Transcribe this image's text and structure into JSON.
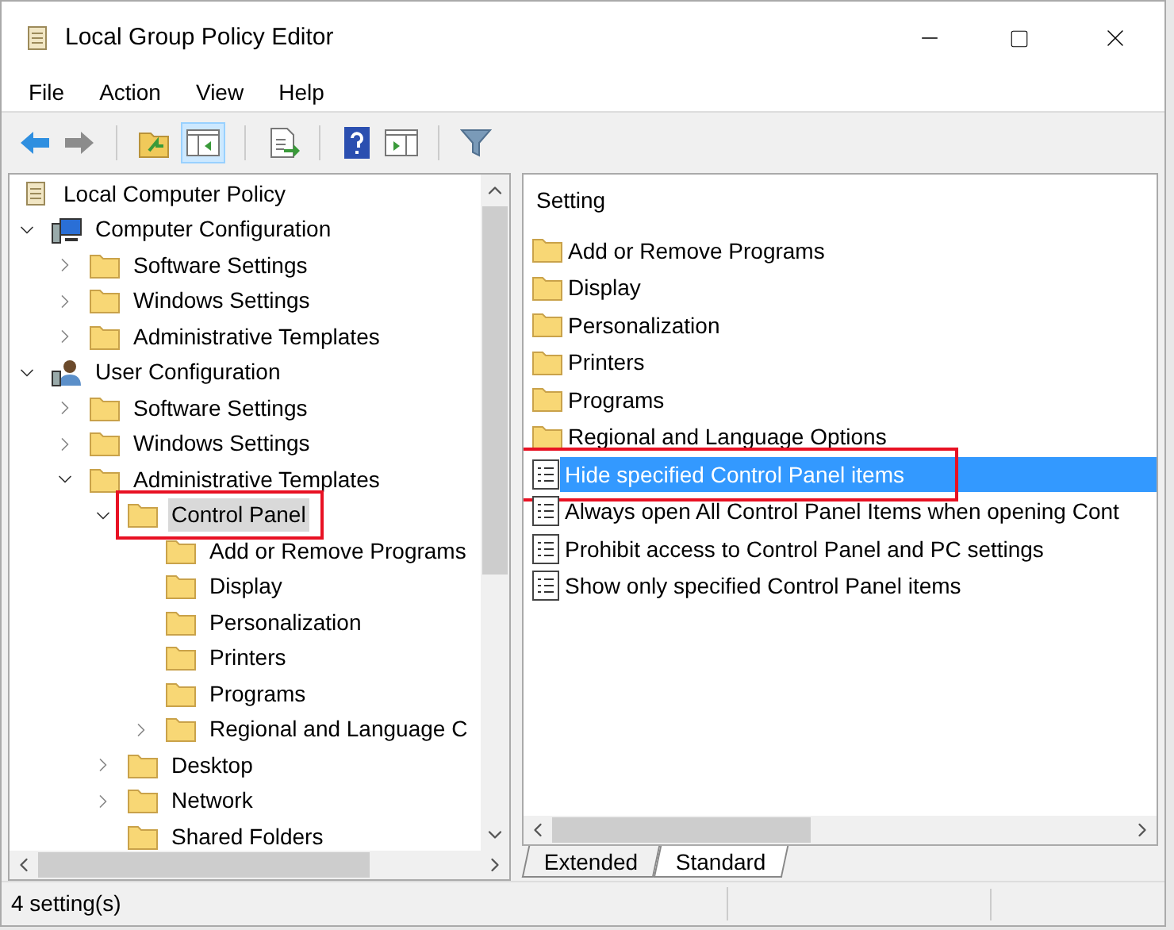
{
  "window": {
    "title": "Local Group Policy Editor"
  },
  "menu": [
    "File",
    "Action",
    "View",
    "Help"
  ],
  "toolbar": [
    {
      "kind": "back"
    },
    {
      "kind": "forward"
    },
    {
      "kind": "sep"
    },
    {
      "kind": "up"
    },
    {
      "kind": "tree",
      "selected": true
    },
    {
      "kind": "sep"
    },
    {
      "kind": "export"
    },
    {
      "kind": "sep"
    },
    {
      "kind": "help"
    },
    {
      "kind": "pane"
    },
    {
      "kind": "sep"
    },
    {
      "kind": "filter"
    }
  ],
  "tree": [
    {
      "label": "Local Computer Policy",
      "kind": "policy",
      "selected": false,
      "annotated": false,
      "children": [
        {
          "label": "Computer Configuration",
          "kind": "computer",
          "expanded": true,
          "selected": false,
          "annotated": false,
          "children": [
            {
              "label": "Software Settings",
              "kind": "folder",
              "expanded": false,
              "selected": false,
              "annotated": false
            },
            {
              "label": "Windows Settings",
              "kind": "folder",
              "expanded": false,
              "selected": false,
              "annotated": false
            },
            {
              "label": "Administrative Templates",
              "kind": "folder",
              "expanded": false,
              "selected": false,
              "annotated": false
            }
          ]
        },
        {
          "label": "User Configuration",
          "kind": "user",
          "expanded": true,
          "selected": false,
          "annotated": false,
          "children": [
            {
              "label": "Software Settings",
              "kind": "folder",
              "expanded": false,
              "selected": false,
              "annotated": false
            },
            {
              "label": "Windows Settings",
              "kind": "folder",
              "expanded": false,
              "selected": false,
              "annotated": false
            },
            {
              "label": "Administrative Templates",
              "kind": "folder",
              "expanded": true,
              "selected": false,
              "annotated": false,
              "children": [
                {
                  "label": "Control Panel",
                  "kind": "folder",
                  "expanded": true,
                  "selected": true,
                  "annotated": true,
                  "children": [
                    {
                      "label": "Add or Remove Programs",
                      "kind": "folder",
                      "selected": false,
                      "annotated": false
                    },
                    {
                      "label": "Display",
                      "kind": "folder",
                      "selected": false,
                      "annotated": false
                    },
                    {
                      "label": "Personalization",
                      "kind": "folder",
                      "selected": false,
                      "annotated": false
                    },
                    {
                      "label": "Printers",
                      "kind": "folder",
                      "selected": false,
                      "annotated": false
                    },
                    {
                      "label": "Programs",
                      "kind": "folder",
                      "selected": false,
                      "annotated": false
                    },
                    {
                      "label": "Regional and Language C",
                      "kind": "folder",
                      "expanded": false,
                      "selected": false,
                      "annotated": false
                    }
                  ]
                },
                {
                  "label": "Desktop",
                  "kind": "folder",
                  "expanded": false,
                  "selected": false,
                  "annotated": false
                },
                {
                  "label": "Network",
                  "kind": "folder",
                  "expanded": false,
                  "selected": false,
                  "annotated": false
                },
                {
                  "label": "Shared Folders",
                  "kind": "folder",
                  "selected": false,
                  "annotated": false
                }
              ]
            }
          ]
        }
      ]
    }
  ],
  "list": {
    "column": "Setting",
    "items": [
      {
        "label": "Add or Remove Programs",
        "kind": "folder",
        "selected": false,
        "annotated": false
      },
      {
        "label": "Display",
        "kind": "folder",
        "selected": false,
        "annotated": false
      },
      {
        "label": "Personalization",
        "kind": "folder",
        "selected": false,
        "annotated": false
      },
      {
        "label": "Printers",
        "kind": "folder",
        "selected": false,
        "annotated": false
      },
      {
        "label": "Programs",
        "kind": "folder",
        "selected": false,
        "annotated": false
      },
      {
        "label": "Regional and Language Options",
        "kind": "folder",
        "selected": false,
        "annotated": false
      },
      {
        "label": "Hide specified Control Panel items",
        "kind": "setting",
        "selected": true,
        "annotated": true
      },
      {
        "label": "Always open All Control Panel Items when opening Cont",
        "kind": "setting",
        "selected": false,
        "annotated": false
      },
      {
        "label": "Prohibit access to Control Panel and PC settings",
        "kind": "setting",
        "selected": false,
        "annotated": false
      },
      {
        "label": "Show only specified Control Panel items",
        "kind": "setting",
        "selected": false,
        "annotated": false
      }
    ]
  },
  "tabs": [
    {
      "label": "Extended",
      "selected": false
    },
    {
      "label": "Standard",
      "selected": true
    }
  ],
  "status_bar": [
    "4 setting(s)"
  ]
}
